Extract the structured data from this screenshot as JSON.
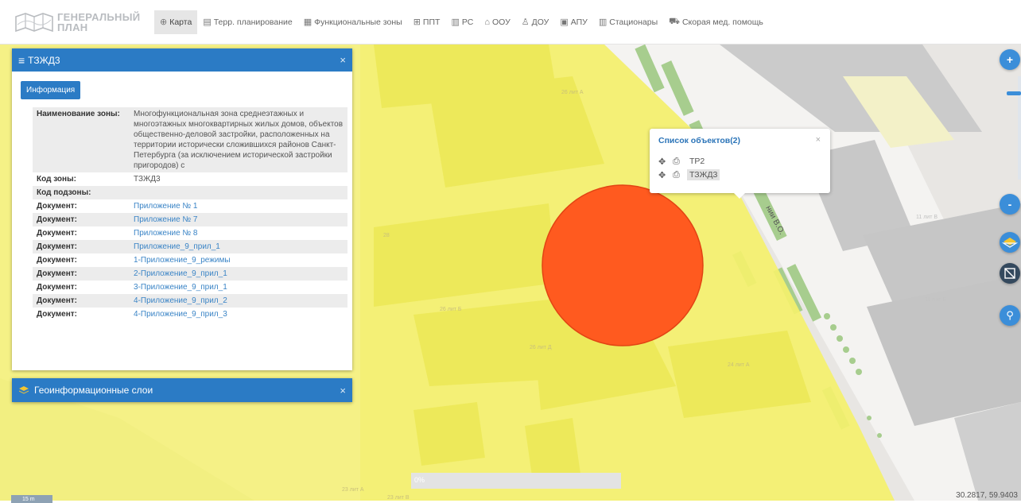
{
  "app": {
    "logo_line1": "ГЕНЕРАЛЬНЫЙ",
    "logo_line2": "ПЛАН"
  },
  "nav": [
    {
      "label": "Карта",
      "icon": "globe-icon",
      "glyph": "⊕",
      "active": true
    },
    {
      "label": "Терр. планирование",
      "icon": "document-icon",
      "glyph": "▤",
      "active": false
    },
    {
      "label": "Функциональные зоны",
      "icon": "grid-icon",
      "glyph": "▦",
      "active": false
    },
    {
      "label": "ППТ",
      "icon": "table-icon",
      "glyph": "⊞",
      "active": false
    },
    {
      "label": "РС",
      "icon": "file-icon",
      "glyph": "▥",
      "active": false
    },
    {
      "label": "ООУ",
      "icon": "building-icon",
      "glyph": "⌂",
      "active": false
    },
    {
      "label": "ДОУ",
      "icon": "child-icon",
      "glyph": "♙",
      "active": false
    },
    {
      "label": "АПУ",
      "icon": "id-card-icon",
      "glyph": "▣",
      "active": false
    },
    {
      "label": "Стационары",
      "icon": "hospital-icon",
      "glyph": "▥",
      "active": false
    },
    {
      "label": "Скорая мед. помощь",
      "icon": "ambulance-icon",
      "glyph": "⛟",
      "active": false
    }
  ],
  "zone_panel": {
    "title": "ТЗЖД3",
    "info_button": "Информация",
    "rows": [
      {
        "key": "Наименование зоны:",
        "value": "Многофункциональная зона среднеэтажных и многоэтажных многоквартирных жилых домов, объектов общественно-деловой застройки, расположенных на территории исторически сложившихся районов Санкт-Петербурга (за исключением исторической застройки пригородов) с",
        "link": false
      },
      {
        "key": "Код зоны:",
        "value": "ТЗЖД3",
        "link": false
      },
      {
        "key": "Код подзоны:",
        "value": "",
        "link": false
      },
      {
        "key": "Документ:",
        "value": "Приложение № 1",
        "link": true
      },
      {
        "key": "Документ:",
        "value": "Приложение № 7",
        "link": true
      },
      {
        "key": "Документ:",
        "value": "Приложение № 8",
        "link": true
      },
      {
        "key": "Документ:",
        "value": "Приложение_9_прил_1",
        "link": true
      },
      {
        "key": "Документ:",
        "value": "1-Приложение_9_режимы",
        "link": true
      },
      {
        "key": "Документ:",
        "value": "2-Приложение_9_прил_1",
        "link": true
      },
      {
        "key": "Документ:",
        "value": "3-Приложение_9_прил_1",
        "link": true
      },
      {
        "key": "Документ:",
        "value": "4-Приложение_9_прил_2",
        "link": true
      },
      {
        "key": "Документ:",
        "value": "4-Приложение_9_прил_3",
        "link": true
      }
    ]
  },
  "layers_panel": {
    "title": "Геоинформационные слои"
  },
  "popup": {
    "title": "Список объектов(2)",
    "items": [
      {
        "label": "ТР2",
        "selected": false
      },
      {
        "label": "ТЗЖД3",
        "selected": true
      }
    ]
  },
  "map": {
    "street_label": "нии В.О.",
    "labels": [
      "26 лит А",
      "26 лит Б",
      "26 лит Д",
      "24 лит А",
      "11 лит В",
      "11 лит Е",
      "28",
      "23 лит А",
      "23 лит В",
      "25 лит А"
    ],
    "colors": {
      "zone_yellow": "#f4f16d",
      "zone_yellow_dim": "#e9e790",
      "circle": "#ff5a1f",
      "building": "#c9c9c9",
      "green": "#a7cd8e",
      "sand": "#d2be9b"
    }
  },
  "progress": {
    "text": "0%",
    "value": 0
  },
  "coords": "30.2817, 59.9403",
  "scale": "15 m",
  "close_glyph": "×",
  "menu_glyph": "≡",
  "controls": {
    "zoom_in": "+",
    "zoom_out": "-",
    "search": "⚲"
  },
  "popup_icons": {
    "move": "✥",
    "print": "⎙"
  }
}
